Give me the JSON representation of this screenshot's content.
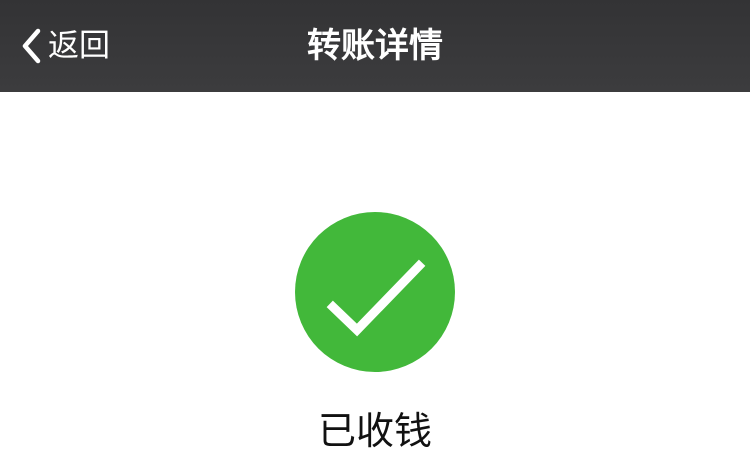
{
  "nav": {
    "back_label": "返回",
    "title": "转账详情",
    "back_icon": "chevron-left-icon",
    "background_color": "#363638"
  },
  "status": {
    "icon": "check-circle-icon",
    "icon_color": "#42b83a",
    "text": "已收钱"
  }
}
